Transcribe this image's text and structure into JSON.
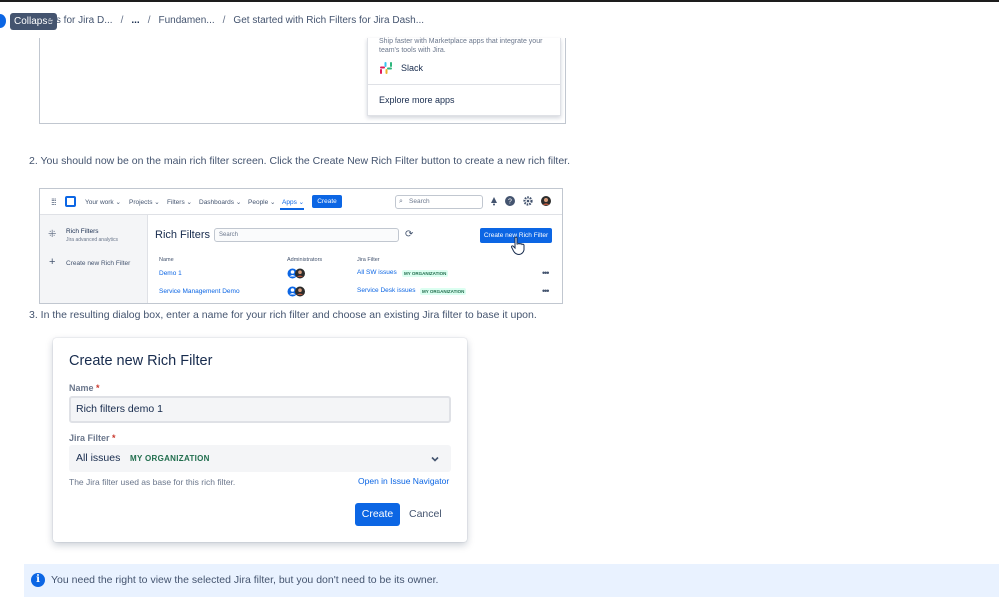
{
  "header": {
    "collapse_tooltip": "Collapse",
    "breadcrumb": [
      "ers for Jira D...",
      "...",
      "Fundamen...",
      "Get started with Rich Filters for Jira Dash..."
    ],
    "separator": "/"
  },
  "image1": {
    "blurb": "Ship faster with Marketplace apps that integrate your team's tools with Jira.",
    "slack_label": "Slack",
    "explore_label": "Explore more apps"
  },
  "steps": {
    "step2": "2. You should now be on the main rich filter screen. Click the Create New Rich Filter button to create a new rich filter.",
    "step3": "3. In the resulting dialog box, enter a name for your rich filter and choose an existing Jira filter to base it upon."
  },
  "image2": {
    "nav": {
      "your_work": "Your work",
      "projects": "Projects",
      "filters": "Filters",
      "dashboards": "Dashboards",
      "people": "People",
      "apps": "Apps",
      "create": "Create",
      "search_placeholder": "Search"
    },
    "sidebar": {
      "title": "Rich Filters",
      "subtitle": "Jira advanced analytics",
      "create": "Create new Rich Filter"
    },
    "heading": "Rich Filters",
    "search_placeholder": "Search",
    "new_button": "Create new Rich Filter",
    "columns": [
      "Name",
      "Administrators",
      "Jira Filter"
    ],
    "rows": [
      {
        "name": "Demo 1",
        "filter": "All SW issues",
        "scope": "MY ORGANIZATION"
      },
      {
        "name": "Service Management Demo",
        "filter": "Service Desk issues",
        "scope": "MY ORGANIZATION"
      }
    ],
    "more_glyph": "•••"
  },
  "dialog": {
    "title": "Create new Rich Filter",
    "name_label": "Name",
    "required_mark": "*",
    "name_value": "Rich filters demo 1",
    "jira_filter_label": "Jira Filter",
    "jira_filter_value": "All issues",
    "jira_filter_scope": "MY ORGANIZATION",
    "help_text": "The Jira filter used as base for this rich filter.",
    "open_link": "Open in Issue Navigator",
    "create_button": "Create",
    "cancel_button": "Cancel"
  },
  "info": {
    "text": "You need the right to view the selected Jira filter, but you don't need to be its owner."
  },
  "colors": {
    "primary": "#0c66e4",
    "lozenge_text": "#216e4e",
    "lozenge_bg": "#dcfff1",
    "info_bg": "#e9f2ff"
  }
}
